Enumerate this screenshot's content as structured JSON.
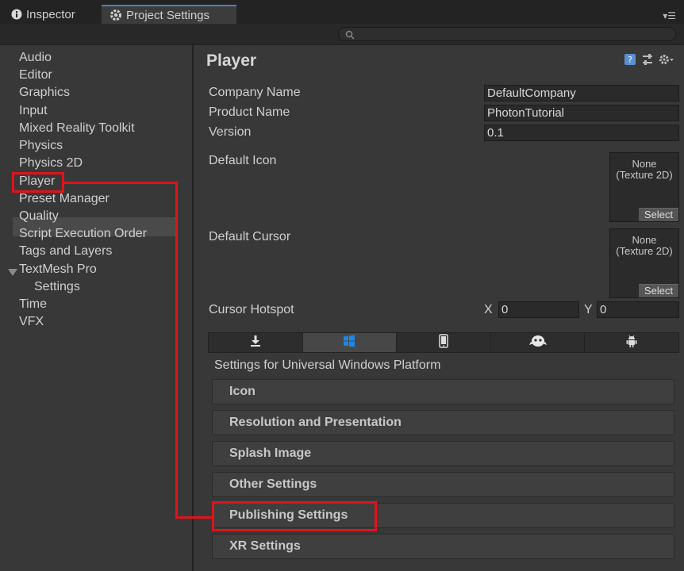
{
  "tabs": {
    "inspector": "Inspector",
    "project_settings": "Project Settings"
  },
  "sidebar": {
    "items": [
      {
        "label": "Audio"
      },
      {
        "label": "Editor"
      },
      {
        "label": "Graphics"
      },
      {
        "label": "Input"
      },
      {
        "label": "Mixed Reality Toolkit"
      },
      {
        "label": "Physics"
      },
      {
        "label": "Physics 2D"
      },
      {
        "label": "Player"
      },
      {
        "label": "Preset Manager"
      },
      {
        "label": "Quality"
      },
      {
        "label": "Script Execution Order"
      },
      {
        "label": "Tags and Layers"
      },
      {
        "label": "TextMesh Pro"
      },
      {
        "label": "Settings"
      },
      {
        "label": "Time"
      },
      {
        "label": "VFX"
      }
    ],
    "selected": "Player"
  },
  "main": {
    "title": "Player",
    "company_name_label": "Company Name",
    "company_name_value": "DefaultCompany",
    "product_name_label": "Product Name",
    "product_name_value": "PhotonTutorial",
    "version_label": "Version",
    "version_value": "0.1",
    "default_icon_label": "Default Icon",
    "default_cursor_label": "Default Cursor",
    "texture_none": "None",
    "texture_type": "(Texture 2D)",
    "select_label": "Select",
    "cursor_hotspot_label": "Cursor Hotspot",
    "x_label": "X",
    "x_value": "0",
    "y_label": "Y",
    "y_value": "0",
    "platform_tabs": [
      "download-icon",
      "windows-icon",
      "phone-icon",
      "webgl-icon",
      "android-icon"
    ],
    "platform_settings_label": "Settings for Universal Windows Platform",
    "sections": [
      {
        "label": "Icon"
      },
      {
        "label": "Resolution and Presentation"
      },
      {
        "label": "Splash Image"
      },
      {
        "label": "Other Settings"
      },
      {
        "label": "Publishing Settings"
      },
      {
        "label": "XR Settings"
      }
    ]
  },
  "colors": {
    "highlight": "#e0131b",
    "accent": "#4a7fc4",
    "windows_blue": "#1e88e5"
  }
}
